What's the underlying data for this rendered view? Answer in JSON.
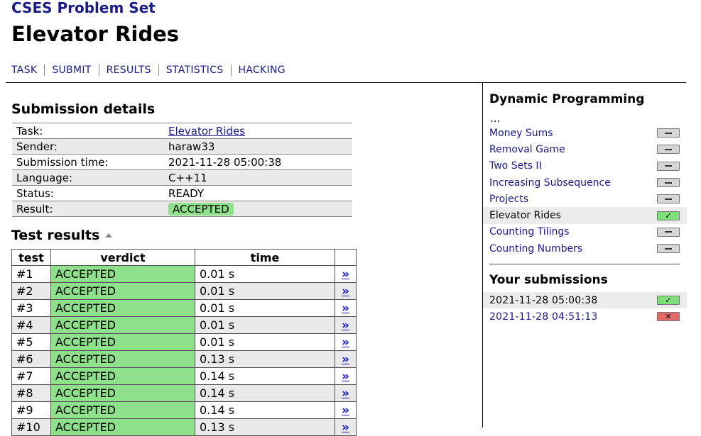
{
  "header": {
    "site_title": "CSES Problem Set",
    "page_title": "Elevator Rides",
    "nav": [
      "TASK",
      "SUBMIT",
      "RESULTS",
      "STATISTICS",
      "HACKING"
    ]
  },
  "submission": {
    "title": "Submission details",
    "rows": [
      {
        "key": "Task:",
        "value": "Elevator Rides"
      },
      {
        "key": "Sender:",
        "value": "haraw33"
      },
      {
        "key": "Submission time:",
        "value": "2021-11-28 05:00:38"
      },
      {
        "key": "Language:",
        "value": "C++11"
      },
      {
        "key": "Status:",
        "value": "READY"
      },
      {
        "key": "Result:",
        "value": "ACCEPTED"
      }
    ]
  },
  "tests": {
    "title": "Test results",
    "headers": {
      "test": "test",
      "verdict": "verdict",
      "time": "time"
    },
    "link_glyph": "»",
    "rows": [
      {
        "num": "#1",
        "verdict": "ACCEPTED",
        "time": "0.01 s"
      },
      {
        "num": "#2",
        "verdict": "ACCEPTED",
        "time": "0.01 s"
      },
      {
        "num": "#3",
        "verdict": "ACCEPTED",
        "time": "0.01 s"
      },
      {
        "num": "#4",
        "verdict": "ACCEPTED",
        "time": "0.01 s"
      },
      {
        "num": "#5",
        "verdict": "ACCEPTED",
        "time": "0.01 s"
      },
      {
        "num": "#6",
        "verdict": "ACCEPTED",
        "time": "0.13 s"
      },
      {
        "num": "#7",
        "verdict": "ACCEPTED",
        "time": "0.14 s"
      },
      {
        "num": "#8",
        "verdict": "ACCEPTED",
        "time": "0.14 s"
      },
      {
        "num": "#9",
        "verdict": "ACCEPTED",
        "time": "0.14 s"
      },
      {
        "num": "#10",
        "verdict": "ACCEPTED",
        "time": "0.13 s"
      }
    ]
  },
  "sidebar": {
    "section_title": "Dynamic Programming",
    "ellipsis": "...",
    "problems": [
      {
        "name": "Money Sums",
        "status": "none"
      },
      {
        "name": "Removal Game",
        "status": "none"
      },
      {
        "name": "Two Sets II",
        "status": "none"
      },
      {
        "name": "Increasing Subsequence",
        "status": "none"
      },
      {
        "name": "Projects",
        "status": "none"
      },
      {
        "name": "Elevator Rides",
        "status": "accepted"
      },
      {
        "name": "Counting Tilings",
        "status": "none"
      },
      {
        "name": "Counting Numbers",
        "status": "none"
      }
    ],
    "submissions_title": "Your submissions",
    "submissions": [
      {
        "time": "2021-11-28 05:00:38",
        "status": "accepted"
      },
      {
        "time": "2021-11-28 04:51:13",
        "status": "failed"
      }
    ],
    "glyphs": {
      "ok": "✓",
      "fail": "✕"
    }
  },
  "colors": {
    "link": "#1a1a8c",
    "accepted": "#8ee08a",
    "failed": "#e46a6a",
    "row_alt": "#eaeaea"
  }
}
